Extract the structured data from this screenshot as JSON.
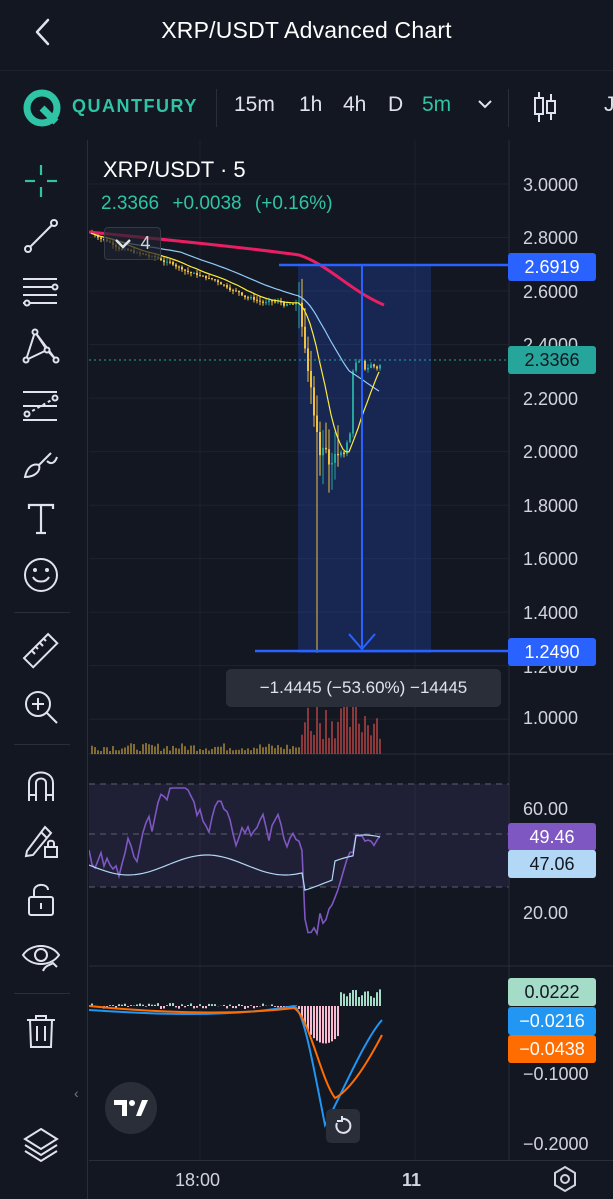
{
  "header": {
    "title": "XRP/USDT Advanced Chart",
    "back_icon": "chevron-left-icon"
  },
  "toolbar": {
    "brand": "QUANTFURY",
    "timeframes": [
      {
        "label": "15m",
        "active": false
      },
      {
        "label": "1h",
        "active": false
      },
      {
        "label": "4h",
        "active": false
      },
      {
        "label": "D",
        "active": false
      },
      {
        "label": "5m",
        "active": true
      }
    ],
    "more_label": "J",
    "colors": {
      "brand": "#2ec4a5"
    }
  },
  "sidebar": {
    "tools": [
      "crosshair-icon",
      "trend-line-icon",
      "fib-retracement-icon",
      "pattern-icon",
      "prediction-icon",
      "brush-icon",
      "text-icon",
      "emoji-icon",
      "ruler-icon",
      "zoom-in-icon",
      "magnet-icon",
      "lock-drawing-icon",
      "unlock-icon",
      "eye-icon",
      "trash-icon",
      "layers-icon"
    ]
  },
  "legend": {
    "symbol": "XRP/USDT · 5",
    "last": "2.3366",
    "change": "+0.0038",
    "change_pct": "(+0.16%)",
    "indicator_count": "4"
  },
  "price_axis": {
    "labels": [
      "3.0000",
      "2.8000",
      "2.6000",
      "2.4000",
      "2.2000",
      "2.0000",
      "1.8000",
      "1.6000",
      "1.4000",
      "1.2000",
      "1.0000"
    ],
    "tags": {
      "measure_high": "2.6919",
      "last": "2.3366",
      "measure_low": "1.2490"
    }
  },
  "measure": {
    "label": "−1.4445 (−53.60%) −14445"
  },
  "rsi": {
    "labels": [
      "60.00",
      "20.00"
    ],
    "rsi_value": "49.46",
    "ma_value": "47.06"
  },
  "macd": {
    "labels": [
      "−0.1000",
      "−0.2000"
    ],
    "histogram": "0.0222",
    "macd": "−0.0216",
    "signal": "−0.0438"
  },
  "time_axis": {
    "labels": [
      "18:00",
      "11"
    ]
  },
  "colors": {
    "up": "#26a69a",
    "down": "#ef5350",
    "accent": "#2962ff",
    "rsi": "#7e57c2",
    "macd": "#2196f3",
    "signal": "#ff6d00"
  }
}
